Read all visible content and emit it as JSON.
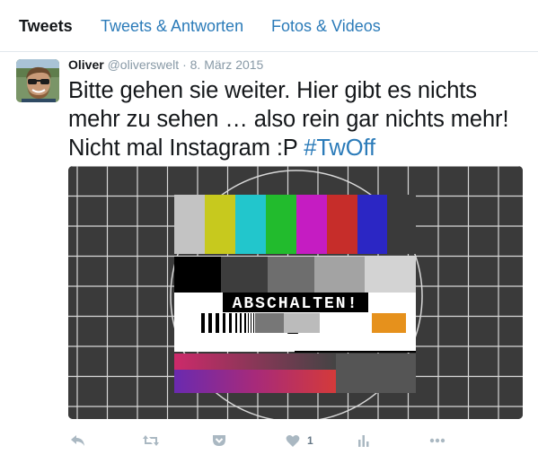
{
  "tabs": [
    {
      "label": "Tweets"
    },
    {
      "label": "Tweets & Antworten"
    },
    {
      "label": "Fotos & Videos"
    }
  ],
  "tweet": {
    "author_name": "Oliver",
    "author_handle": "@oliverswelt",
    "separator": "·",
    "date": "8. März 2015",
    "text_line1": "Bitte gehen sie weiter. Hier gibt es nichts",
    "text_line2": "mehr zu sehen … also rein gar nichts mehr!",
    "text_line3": "Nicht mal Instagram :P",
    "hashtag": "#TwOff",
    "media_label": "ABSCHALTEN!",
    "like_count": "1"
  },
  "icons": {
    "reply": "reply-icon",
    "retweet": "retweet-icon",
    "pocket": "pocket-icon",
    "like": "heart-icon",
    "analytics": "analytics-icon",
    "more": "more-icon"
  },
  "colors": {
    "accent": "#2b7bb9",
    "text": "#14171a",
    "muted": "#8899a6",
    "icon": "#aab8c2"
  }
}
